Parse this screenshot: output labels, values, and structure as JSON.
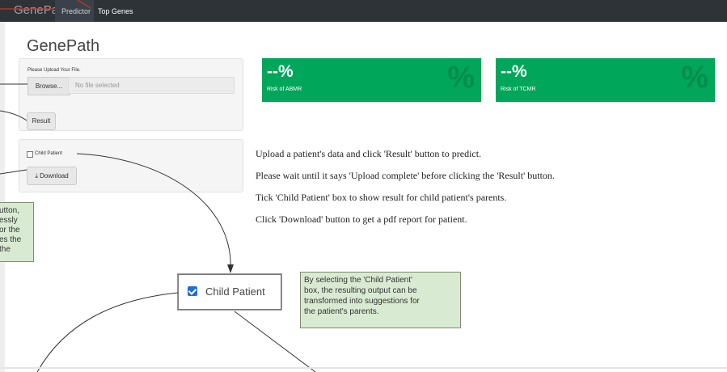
{
  "navbar": {
    "brand": "GenePath",
    "tabs": [
      {
        "label": "Predictor",
        "active": true
      },
      {
        "label": "Top Genes",
        "active": false
      }
    ]
  },
  "page_title": "GenePath",
  "upload": {
    "label": "Please Upload Your File.",
    "browse_label": "Browse...",
    "file_placeholder": "No file selected",
    "result_label": "Result"
  },
  "options": {
    "child_patient_label": "Child Patient",
    "download_label": "Download"
  },
  "risk_boxes": [
    {
      "value": "--%",
      "label": "Risk of ABMR"
    },
    {
      "value": "--%",
      "label": "Risk of TCMR"
    }
  ],
  "instructions": [
    "Upload a patient's data and click 'Result' button to predict.",
    "Please wait until it says 'Upload complete' before clicking the 'Result' button.",
    "Tick 'Child Patient' box to show result for child patient's parents.",
    "Click 'Download' button to get a pdf report for patient."
  ],
  "callout_left": {
    "lines": [
      "utton,",
      "essly",
      "or the",
      "es the",
      " the"
    ]
  },
  "callout_right": {
    "lines": [
      "By selecting the 'Child Patient'",
      "box, the resulting output can be",
      "transformed into suggestions for",
      "the patient's parents."
    ]
  },
  "zoomed_child": {
    "label": "Child Patient",
    "checked": true
  },
  "colors": {
    "navbar": "#2e3338",
    "risk_green": "#00a65a",
    "callout_bg": "#d9ead3",
    "checkbox_blue": "#1e6fd9"
  }
}
